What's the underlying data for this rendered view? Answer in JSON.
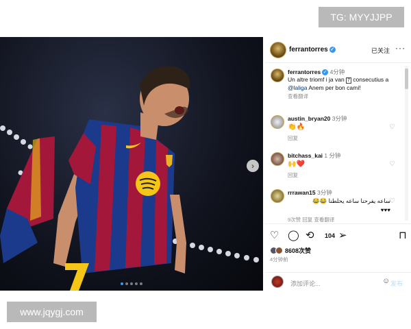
{
  "watermarks": {
    "top": "TG: MYYJJPP",
    "bottom": "www.jqygj.com"
  },
  "post": {
    "username": "ferrantorres",
    "follow_label": "已关注",
    "more_label": "···",
    "next_label": "›",
    "carousel": {
      "count": 5,
      "active_index": 0
    },
    "caption": {
      "username": "ferrantorres",
      "time": "4分钟",
      "text_1": "Un altre triomf i ja van ",
      "box_num": "7",
      "text_2": " consecutius a ",
      "mention": "@laliga",
      "text_3": " Anem per bon camí!",
      "see_translation": "查看翻译"
    },
    "comments": [
      {
        "username": "austin_bryan20",
        "time": "3分钟",
        "text": "👏🔥",
        "reply": "回复"
      },
      {
        "username": "bitchass_kai",
        "time": "1 分钟",
        "text": "🙌❤️",
        "reply": "回复"
      },
      {
        "username": "rrrawan15",
        "time": "3分钟",
        "text": "ساعه يفرحنا ساعه يحلطنا 😂😂",
        "text_2": "♥♥♥"
      }
    ],
    "partial_meta": "9次赞   回复   查看翻译",
    "likes_count": "8608次赞",
    "repost_count": "104",
    "posted_time": "4分钟前",
    "comment_placeholder": "添加评论...",
    "post_button": "发布",
    "icons": [
      "heart-icon",
      "comment-icon",
      "repost-icon",
      "share-icon",
      "save-icon",
      "emoji-icon",
      "user-tag-icon"
    ],
    "colors": {
      "accent": "#3897f0",
      "verified": "#3897f0",
      "barca_blue": "#1c3a8c",
      "barca_red": "#a3173a",
      "spotify_yellow": "#f5c518"
    }
  }
}
